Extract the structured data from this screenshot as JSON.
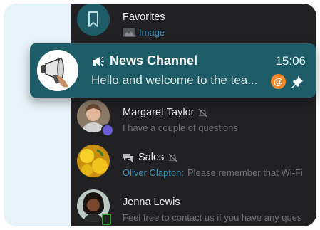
{
  "chats": [
    {
      "name": "Favorites",
      "preview_image_label": "Image"
    },
    {
      "name": "News Channel",
      "time": "15:06",
      "preview": "Hello and welcome to the tea...",
      "mention": "@"
    },
    {
      "name": "Margaret Taylor",
      "preview": "I have a couple of questions"
    },
    {
      "name": "Sales",
      "sender": "Oliver Clapton:",
      "preview": "Please remember that Wi-Fi"
    },
    {
      "name": "Jenna Lewis",
      "preview": "Feel free to contact us if you have any ques"
    }
  ],
  "icons": {
    "favorites": "bookmark-icon",
    "channel": "megaphone-icon",
    "group": "group-chat-icon",
    "muted": "muted-bell-icon",
    "pin": "pin-icon"
  },
  "colors": {
    "highlight": "#1e5c67",
    "dark_background": "#212124",
    "light_background": "#e6f3fa",
    "accent_link": "#3f8fb6",
    "mention_badge": "#f5882a"
  }
}
